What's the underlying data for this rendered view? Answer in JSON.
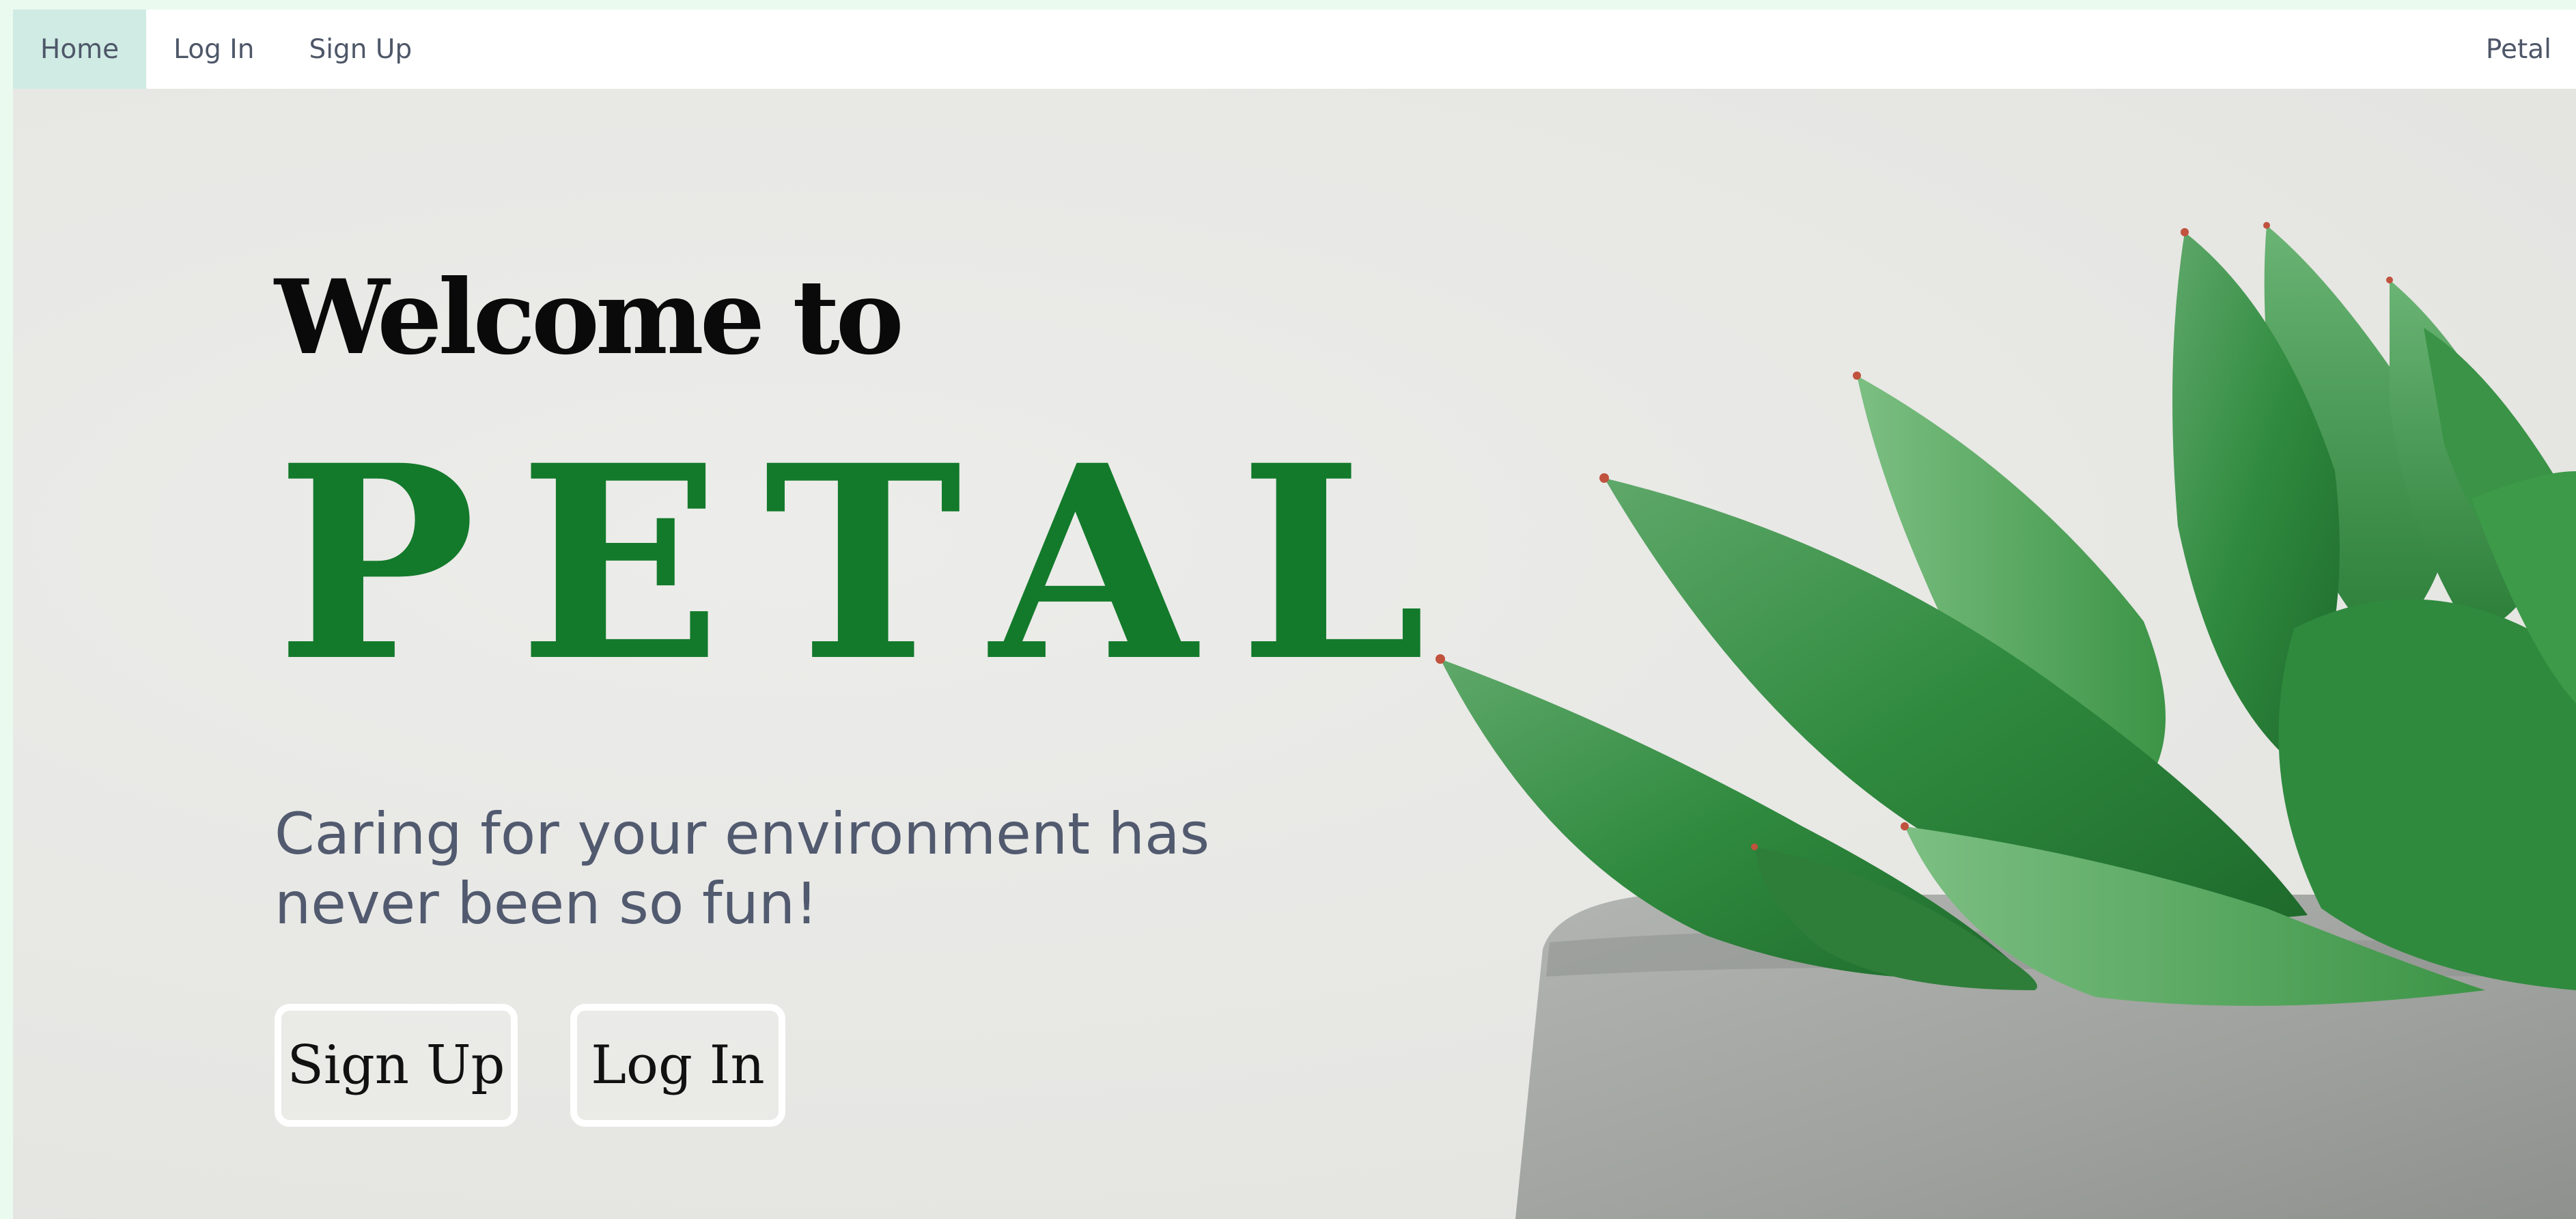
{
  "nav": {
    "home": "Home",
    "login": "Log In",
    "signup": "Sign Up",
    "brand": "Petal"
  },
  "hero": {
    "welcome": "Welcome to",
    "brand": "PETAL",
    "tagline": "Caring for your environment has never been so fun!",
    "signup_button": "Sign Up",
    "login_button": "Log In"
  },
  "colors": {
    "accent_green": "#137a2b",
    "nav_active_bg": "#cfebe4",
    "text_gray": "#515a6e"
  }
}
